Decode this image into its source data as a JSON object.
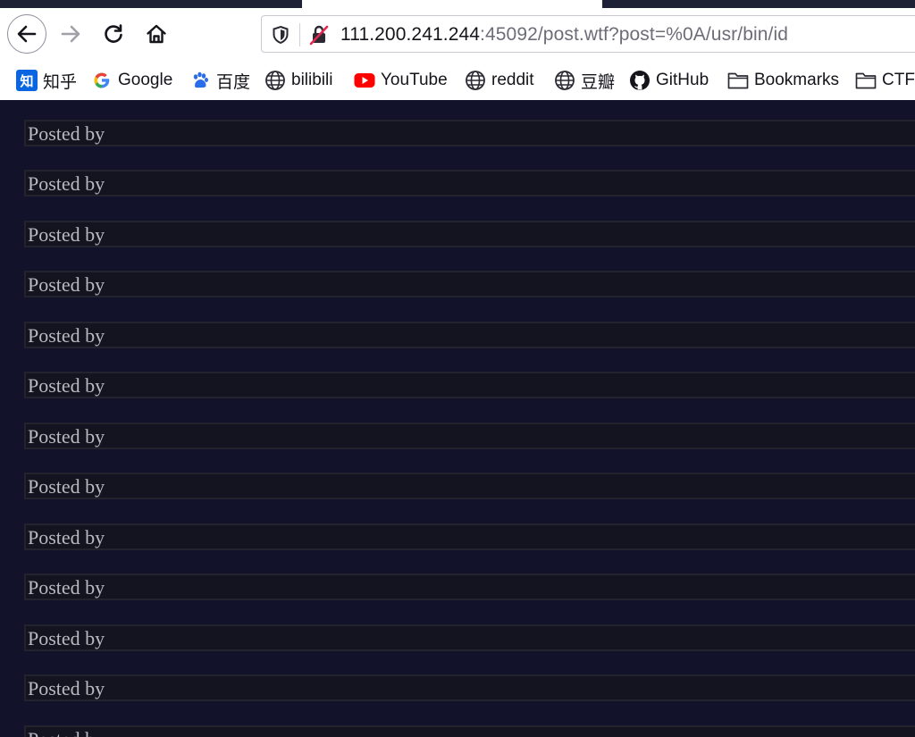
{
  "url": {
    "host": "111.200.241.244",
    "rest": ":45092/post.wtf?post=%0A/usr/bin/id"
  },
  "nav_icons": {
    "back": "back-arrow-icon",
    "forward": "forward-arrow-icon",
    "reload": "reload-icon",
    "home": "home-icon",
    "tracking": "shield-icon",
    "insecure": "insecure-lock-icon"
  },
  "bookmarks": [
    {
      "label": "知乎",
      "icon": "zhihu-icon",
      "icon_text": "知"
    },
    {
      "label": "Google",
      "icon": "google-icon"
    },
    {
      "label": "百度",
      "icon": "baidu-paw-icon"
    },
    {
      "label": "bilibili",
      "icon": "globe-icon"
    },
    {
      "label": "YouTube",
      "icon": "youtube-icon"
    },
    {
      "label": "reddit",
      "icon": "globe-icon"
    },
    {
      "label": "豆瓣",
      "icon": "globe-icon"
    },
    {
      "label": "GitHub",
      "icon": "github-icon"
    },
    {
      "label": "Bookmarks",
      "icon": "folder-icon"
    },
    {
      "label": "CTF",
      "icon": "folder-icon"
    }
  ],
  "posts": [
    {
      "text": "Posted by"
    },
    {
      "text": "Posted by"
    },
    {
      "text": "Posted by"
    },
    {
      "text": "Posted by"
    },
    {
      "text": "Posted by"
    },
    {
      "text": "Posted by"
    },
    {
      "text": "Posted by"
    },
    {
      "text": "Posted by"
    },
    {
      "text": "Posted by"
    },
    {
      "text": "Posted by"
    },
    {
      "text": "Posted by"
    },
    {
      "text": "Posted by"
    },
    {
      "text": "Posted by"
    }
  ],
  "colors": {
    "page_background": "#12122a",
    "post_background": "#13141f",
    "post_border": "#22232c",
    "post_text": "#b9b9c1",
    "tabstrip": "#1f2236"
  }
}
